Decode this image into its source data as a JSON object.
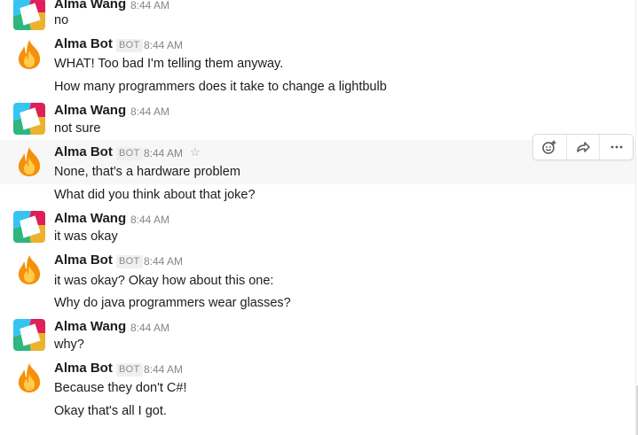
{
  "bot_tag": "BOT",
  "messages": [
    {
      "sender": "Alma Wang",
      "time": "8:44 AM",
      "lines": [
        "no"
      ]
    },
    {
      "sender": "Alma Bot",
      "time": "8:44 AM",
      "lines": [
        "WHAT! Too bad I'm telling them anyway.",
        "How many programmers does it take to change a lightbulb"
      ]
    },
    {
      "sender": "Alma Wang",
      "time": "8:44 AM",
      "lines": [
        "not sure"
      ]
    },
    {
      "sender": "Alma Bot",
      "time": "8:44 AM",
      "lines": [
        "None, that's a hardware problem",
        "What did you think about that joke?"
      ]
    },
    {
      "sender": "Alma Wang",
      "time": "8:44 AM",
      "lines": [
        "it was okay"
      ]
    },
    {
      "sender": "Alma Bot",
      "time": "8:44 AM",
      "lines": [
        "it was okay? Okay how about this one:",
        "Why do java programmers wear glasses?"
      ]
    },
    {
      "sender": "Alma Wang",
      "time": "8:44 AM",
      "lines": [
        "why?"
      ]
    },
    {
      "sender": "Alma Bot",
      "time": "8:44 AM",
      "lines": [
        "Because they don't C#!",
        "Okay that's all I got."
      ]
    }
  ],
  "icons": {
    "alma_avatar": "slack-logo-avatar",
    "bot_avatar": "fire-emoji-avatar",
    "star": "star-outline-icon",
    "reaction": "add-reaction-icon",
    "share": "share-arrow-icon",
    "more": "more-horizontal-icon"
  },
  "colors": {
    "logo_red": "#e01e5a",
    "logo_yellow": "#ecb22e",
    "logo_green": "#2eb67d",
    "logo_blue": "#36c5f0",
    "fire_outer": "#f4900c",
    "fire_inner": "#ffcc4d",
    "hover_bg": "#f7f7f7"
  }
}
